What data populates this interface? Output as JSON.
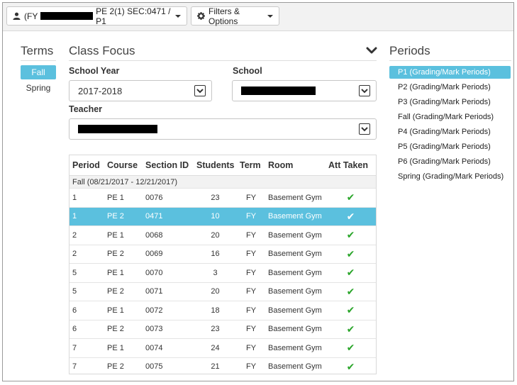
{
  "topbar": {
    "context_prefix": "(FY",
    "context_suffix": "PE 2(1) SEC:0471 / P1",
    "filters_label": "Filters & Options"
  },
  "terms": {
    "title": "Terms",
    "items": [
      {
        "label": "Fall",
        "active": true
      },
      {
        "label": "Spring",
        "active": false
      }
    ]
  },
  "class_focus": {
    "title": "Class Focus",
    "school_year_label": "School Year",
    "school_year_value": "2017-2018",
    "school_label": "School",
    "teacher_label": "Teacher"
  },
  "table": {
    "headers": [
      "Period",
      "Course",
      "Section ID",
      "Students",
      "Term",
      "Room",
      "Att Taken"
    ],
    "group_label": "Fall (08/21/2017 - 12/21/2017)",
    "rows": [
      {
        "period": "1",
        "course": "PE 1",
        "section": "0076",
        "students": "23",
        "term": "FY",
        "room": "Basement Gym",
        "selected": false
      },
      {
        "period": "1",
        "course": "PE 2",
        "section": "0471",
        "students": "10",
        "term": "FY",
        "room": "Basement Gym",
        "selected": true
      },
      {
        "period": "2",
        "course": "PE 1",
        "section": "0068",
        "students": "20",
        "term": "FY",
        "room": "Basement Gym",
        "selected": false
      },
      {
        "period": "2",
        "course": "PE 2",
        "section": "0069",
        "students": "16",
        "term": "FY",
        "room": "Basement Gym",
        "selected": false
      },
      {
        "period": "5",
        "course": "PE 1",
        "section": "0070",
        "students": "3",
        "term": "FY",
        "room": "Basement Gym",
        "selected": false
      },
      {
        "period": "5",
        "course": "PE 2",
        "section": "0071",
        "students": "20",
        "term": "FY",
        "room": "Basement Gym",
        "selected": false
      },
      {
        "period": "6",
        "course": "PE 1",
        "section": "0072",
        "students": "18",
        "term": "FY",
        "room": "Basement Gym",
        "selected": false
      },
      {
        "period": "6",
        "course": "PE 2",
        "section": "0073",
        "students": "23",
        "term": "FY",
        "room": "Basement Gym",
        "selected": false
      },
      {
        "period": "7",
        "course": "PE 1",
        "section": "0074",
        "students": "24",
        "term": "FY",
        "room": "Basement Gym",
        "selected": false
      },
      {
        "period": "7",
        "course": "PE 2",
        "section": "0075",
        "students": "21",
        "term": "FY",
        "room": "Basement Gym",
        "selected": false
      }
    ]
  },
  "periods": {
    "title": "Periods",
    "items": [
      {
        "label": "P1 (Grading/Mark Periods)",
        "active": true
      },
      {
        "label": "P2 (Grading/Mark Periods)",
        "active": false
      },
      {
        "label": "P3 (Grading/Mark Periods)",
        "active": false
      },
      {
        "label": "Fall (Grading/Mark Periods)",
        "active": false
      },
      {
        "label": "P4 (Grading/Mark Periods)",
        "active": false
      },
      {
        "label": "P5 (Grading/Mark Periods)",
        "active": false
      },
      {
        "label": "P6 (Grading/Mark Periods)",
        "active": false
      },
      {
        "label": "Spring (Grading/Mark Periods)",
        "active": false
      }
    ]
  },
  "colors": {
    "accent": "#5bc0de",
    "check": "#2aa52a",
    "redaction": "#000000"
  },
  "icons": {
    "user": "user-icon",
    "filters": "gear-icon",
    "collapse": "chevron-down-icon",
    "select": "chevron-down-icon",
    "attendance": "check-icon"
  }
}
